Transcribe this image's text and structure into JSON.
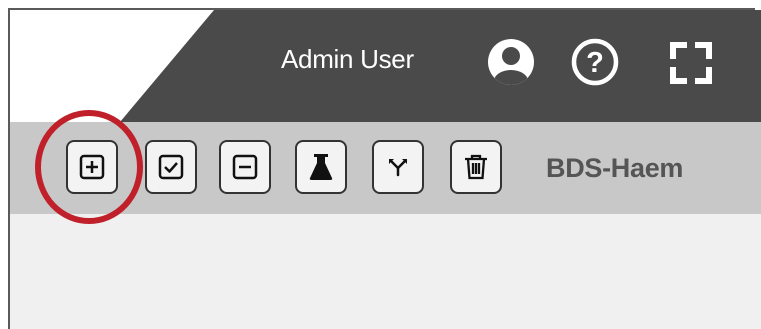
{
  "header": {
    "user_name": "Admin User",
    "background_color": "#4a4a4a",
    "icons": [
      "account-icon",
      "help-icon",
      "fullscreen-icon"
    ]
  },
  "toolbar": {
    "background_color": "#c8c8c8",
    "buttons": [
      {
        "name": "add-button",
        "icon": "plus-square-icon"
      },
      {
        "name": "check-button",
        "icon": "check-square-icon"
      },
      {
        "name": "remove-button",
        "icon": "minus-square-icon"
      },
      {
        "name": "flask-button",
        "icon": "flask-icon"
      },
      {
        "name": "merge-button",
        "icon": "fork-icon"
      },
      {
        "name": "delete-button",
        "icon": "trash-icon"
      }
    ],
    "panel_name": "BDS-Haem"
  },
  "annotation": {
    "highlight_color": "#c0202a",
    "highlighted": "add-button"
  }
}
